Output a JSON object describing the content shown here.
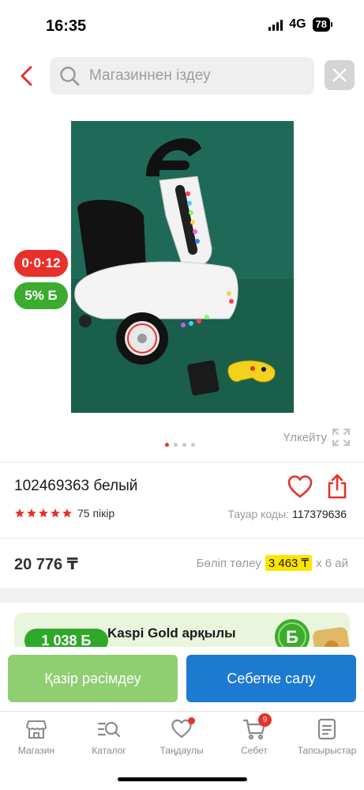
{
  "status_bar": {
    "time": "16:35",
    "network": "4G",
    "battery": "78"
  },
  "search": {
    "placeholder": "Магазиннен іздеу"
  },
  "badges": {
    "installment": "0·0·12",
    "bonus": "5% Б"
  },
  "gallery": {
    "zoom_label": "Үлкейту",
    "total_images": 4,
    "active_index": 0
  },
  "product": {
    "title": "102469363 белый",
    "rating": 5,
    "reviews": "75 пікір",
    "code_label": "Тауар коды:",
    "code_value": "117379636",
    "price": "20 776 ₸",
    "installment_label": "Бөліп төлеу",
    "installment_amount": "3 463 ₸",
    "installment_term": "x 6 ай"
  },
  "kaspi_gold": {
    "bonus": "1 038 Б",
    "text": "Kaspi Gold арқылы төлегенде"
  },
  "actions": {
    "buy_now": "Қазір рәсімдеу",
    "add_to_cart": "Себетке салу"
  },
  "tab_bar": {
    "items": [
      {
        "label": "Магазин",
        "icon": "store-icon"
      },
      {
        "label": "Каталог",
        "icon": "catalog-search-icon"
      },
      {
        "label": "Таңдаулы",
        "icon": "heart-icon"
      },
      {
        "label": "Себет",
        "icon": "cart-icon"
      },
      {
        "label": "Тапсырыстар",
        "icon": "orders-icon"
      }
    ],
    "cart_count": "9"
  },
  "colors": {
    "brand_red": "#e8312a",
    "bonus_green": "#3cab2e",
    "buy_green": "#8fcf72",
    "cart_blue": "#1c7ad0",
    "highlight_yellow": "#ffe400"
  }
}
